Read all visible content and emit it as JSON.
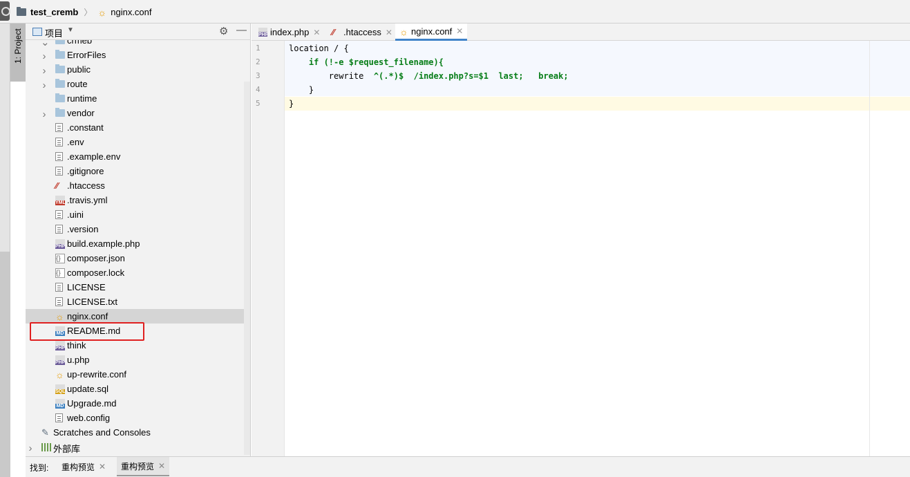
{
  "breadcrumb": {
    "project": "test_cremb",
    "file": "nginx.conf"
  },
  "sidebar_tab": {
    "label": "1: Project"
  },
  "project_panel": {
    "title": "项目",
    "items": [
      {
        "label": "crmeb",
        "kind": "folder",
        "arrow": "expanded",
        "indent": 1
      },
      {
        "label": "ErrorFiles",
        "kind": "folder",
        "arrow": "collapsed",
        "indent": 1
      },
      {
        "label": "public",
        "kind": "folder",
        "arrow": "collapsed",
        "indent": 1
      },
      {
        "label": "route",
        "kind": "folder",
        "arrow": "collapsed",
        "indent": 1
      },
      {
        "label": "runtime",
        "kind": "folder",
        "arrow": "none",
        "indent": 1
      },
      {
        "label": "vendor",
        "kind": "folder",
        "arrow": "collapsed",
        "indent": 1
      },
      {
        "label": ".constant",
        "kind": "text",
        "arrow": "none",
        "indent": 1
      },
      {
        "label": ".env",
        "kind": "text",
        "arrow": "none",
        "indent": 1
      },
      {
        "label": ".example.env",
        "kind": "text",
        "arrow": "none",
        "indent": 1
      },
      {
        "label": ".gitignore",
        "kind": "text",
        "arrow": "none",
        "indent": 1
      },
      {
        "label": ".htaccess",
        "kind": "htaccess",
        "arrow": "none",
        "indent": 1
      },
      {
        "label": ".travis.yml",
        "kind": "yml",
        "arrow": "none",
        "indent": 1
      },
      {
        "label": ".uini",
        "kind": "text",
        "arrow": "none",
        "indent": 1
      },
      {
        "label": ".version",
        "kind": "text",
        "arrow": "none",
        "indent": 1
      },
      {
        "label": "build.example.php",
        "kind": "php",
        "arrow": "none",
        "indent": 1
      },
      {
        "label": "composer.json",
        "kind": "json",
        "arrow": "none",
        "indent": 1
      },
      {
        "label": "composer.lock",
        "kind": "json",
        "arrow": "none",
        "indent": 1
      },
      {
        "label": "LICENSE",
        "kind": "text",
        "arrow": "none",
        "indent": 1
      },
      {
        "label": "LICENSE.txt",
        "kind": "text",
        "arrow": "none",
        "indent": 1
      },
      {
        "label": "nginx.conf",
        "kind": "conf",
        "arrow": "none",
        "indent": 1,
        "selected": true
      },
      {
        "label": "README.md",
        "kind": "md",
        "arrow": "none",
        "indent": 1
      },
      {
        "label": "think",
        "kind": "php",
        "arrow": "none",
        "indent": 1
      },
      {
        "label": "u.php",
        "kind": "php",
        "arrow": "none",
        "indent": 1
      },
      {
        "label": "up-rewrite.conf",
        "kind": "conf",
        "arrow": "none",
        "indent": 1
      },
      {
        "label": "update.sql",
        "kind": "sql",
        "arrow": "none",
        "indent": 1
      },
      {
        "label": "Upgrade.md",
        "kind": "md",
        "arrow": "none",
        "indent": 1
      },
      {
        "label": "web.config",
        "kind": "text",
        "arrow": "none",
        "indent": 1
      },
      {
        "label": "Scratches and Consoles",
        "kind": "scratch",
        "arrow": "none",
        "indent": 0
      },
      {
        "label": "外部库",
        "kind": "lib",
        "arrow": "collapsed",
        "indent": 0
      }
    ]
  },
  "editor_tabs": [
    {
      "label": "index.php",
      "kind": "php",
      "active": false
    },
    {
      "label": ".htaccess",
      "kind": "htaccess",
      "active": false
    },
    {
      "label": "nginx.conf",
      "kind": "conf",
      "active": true
    }
  ],
  "code": {
    "line_numbers": [
      "1",
      "2",
      "3",
      "4",
      "5"
    ],
    "lines": [
      [
        {
          "t": "location / {",
          "c": "kw-plain"
        }
      ],
      [
        {
          "t": "    ",
          "c": "kw-plain"
        },
        {
          "t": "if (!-e $request_filename){",
          "c": "kw-green"
        }
      ],
      [
        {
          "t": "        rewrite  ",
          "c": "kw-plain"
        },
        {
          "t": "^(.*)$  /index.php?s=$1  last;   break;",
          "c": "kw-green"
        }
      ],
      [
        {
          "t": "    }",
          "c": "kw-plain"
        }
      ],
      [
        {
          "t": "}",
          "c": "kw-plain"
        }
      ]
    ]
  },
  "bottom_bar": {
    "find_label": "找到:",
    "tabs": [
      {
        "label": "重构预览",
        "active": false
      },
      {
        "label": "重构预览",
        "active": true
      }
    ]
  },
  "colors": {
    "accent": "#4083c9",
    "highlight_box": "#e02020",
    "code_green": "#067d17"
  }
}
